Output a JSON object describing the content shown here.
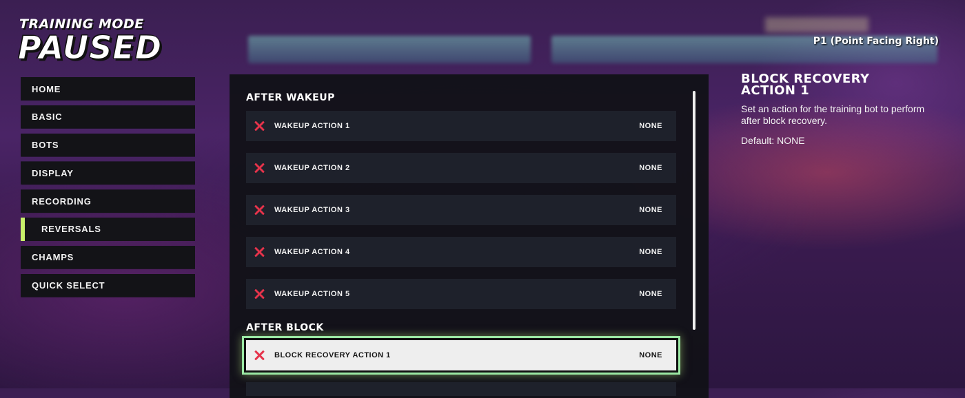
{
  "header": {
    "subtitle": "TRAINING MODE",
    "title": "PAUSED",
    "player_label": "P1 (Point Facing Right)"
  },
  "nav": {
    "items": [
      {
        "label": "HOME"
      },
      {
        "label": "BASIC"
      },
      {
        "label": "BOTS"
      },
      {
        "label": "DISPLAY"
      },
      {
        "label": "RECORDING"
      },
      {
        "label": "REVERSALS",
        "active": true
      },
      {
        "label": "CHAMPS"
      },
      {
        "label": "QUICK SELECT"
      }
    ],
    "active_accent": "#c8f06a"
  },
  "sections": [
    {
      "title": "AFTER WAKEUP",
      "rows": [
        {
          "label": "WAKEUP ACTION 1",
          "value": "NONE"
        },
        {
          "label": "WAKEUP ACTION 2",
          "value": "NONE"
        },
        {
          "label": "WAKEUP ACTION 3",
          "value": "NONE"
        },
        {
          "label": "WAKEUP ACTION 4",
          "value": "NONE"
        },
        {
          "label": "WAKEUP ACTION 5",
          "value": "NONE"
        }
      ]
    },
    {
      "title": "AFTER BLOCK",
      "rows": [
        {
          "label": "BLOCK RECOVERY ACTION 1",
          "value": "NONE",
          "selected": true
        }
      ]
    }
  ],
  "description": {
    "title_line1": "BLOCK RECOVERY",
    "title_line2": "ACTION 1",
    "body": "Set an action for the training bot to perform after block recovery.",
    "default": "Default: NONE"
  },
  "icons": {
    "row_status_icon": "x-icon",
    "row_status_color": "#e5334b"
  },
  "colors": {
    "selection_outline": "#9be8a4"
  }
}
